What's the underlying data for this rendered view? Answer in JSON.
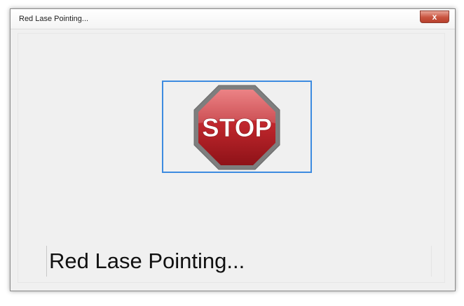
{
  "window": {
    "title": "Red Lase Pointing..."
  },
  "titlebar": {
    "close_glyph": "x",
    "close_icon": "close-icon"
  },
  "content": {
    "sign_text": "STOP",
    "sign_icon": "stop-sign-icon",
    "status_text": "Red Lase Pointing..."
  },
  "colors": {
    "frame_border": "#3d8be0",
    "sign_red": "#c0272d",
    "close_red": "#c9543f"
  }
}
